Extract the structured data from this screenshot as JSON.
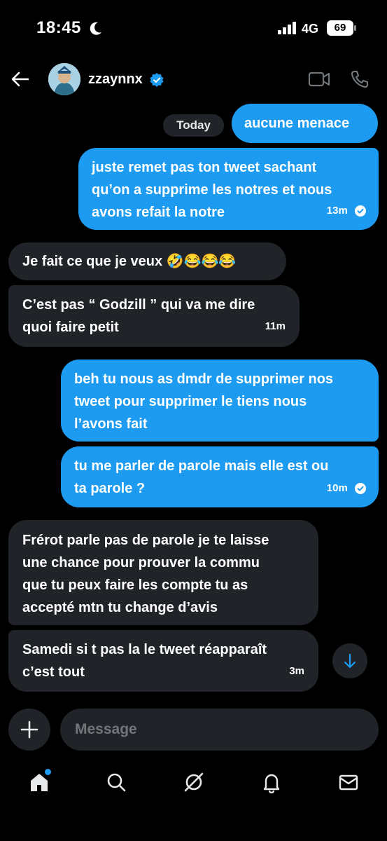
{
  "status_bar": {
    "time": "18:45",
    "network": "4G",
    "battery": "69"
  },
  "header": {
    "username": "zzaynnx",
    "back_icon": "arrow-left-icon",
    "video_icon": "video-camera-icon",
    "call_icon": "phone-icon"
  },
  "conversation": {
    "date_label": "Today",
    "messages": [
      {
        "direction": "outgoing",
        "text": "aucune menace"
      },
      {
        "direction": "outgoing",
        "lines": [
          "juste remet pas ton tweet sachant",
          "qu’on a supprime les notres et nous",
          "avons refait la notre"
        ],
        "time": "13m",
        "read": true
      },
      {
        "direction": "incoming",
        "text": "Je fait ce que je veux 🤣😂😂😂"
      },
      {
        "direction": "incoming",
        "lines": [
          "C’est pas “ Godzill ” qui va me dire",
          "quoi faire petit"
        ],
        "time": "11m"
      },
      {
        "direction": "outgoing",
        "lines": [
          "beh tu nous as dmdr de supprimer nos",
          "tweet pour supprimer le tiens nous",
          "l’avons fait"
        ]
      },
      {
        "direction": "outgoing",
        "lines": [
          "tu me parler de parole mais elle est ou",
          "ta parole ?"
        ],
        "time": "10m",
        "read": true
      },
      {
        "direction": "incoming",
        "lines": [
          "Frérot parle pas de parole je te laisse",
          "une chance pour prouver  la commu",
          "que tu peux faire les compte tu as",
          "accepté mtn tu change d’avis"
        ]
      },
      {
        "direction": "incoming",
        "lines": [
          "Samedi si t pas la le tweet réapparaît",
          "c’est tout"
        ],
        "time": "3m"
      }
    ]
  },
  "composer": {
    "placeholder": "Message",
    "add_icon": "plus-icon"
  },
  "bottom_nav": [
    {
      "name": "home",
      "icon": "home-icon"
    },
    {
      "name": "search",
      "icon": "search-icon"
    },
    {
      "name": "grok",
      "icon": "grok-icon"
    },
    {
      "name": "notifications",
      "icon": "bell-icon"
    },
    {
      "name": "messages",
      "icon": "mail-icon"
    }
  ],
  "colors": {
    "accent": "#1d9bf0",
    "incoming_bubble": "#202327",
    "background": "#000000",
    "muted": "#71767b"
  }
}
